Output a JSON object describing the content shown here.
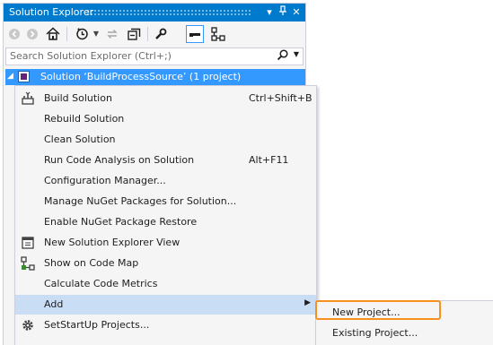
{
  "panel": {
    "title": "Solution Explorer",
    "title_buttons": {
      "dropdown": "▾",
      "pin": "📌",
      "close": "✕"
    }
  },
  "toolbar": {
    "icons": [
      "back-icon",
      "forward-icon",
      "home-icon",
      "history-icon",
      "sync-icon",
      "collapse-all-icon",
      "properties-icon",
      "preview-icon",
      "show-on-code-map-icon"
    ]
  },
  "search": {
    "placeholder": "Search Solution Explorer (Ctrl+;)"
  },
  "solution": {
    "label": "Solution ‘BuildProcessSource’ (1 project)"
  },
  "context_menu": {
    "items": [
      {
        "label": "Build Solution",
        "shortcut": "Ctrl+Shift+B",
        "icon": "build-icon"
      },
      {
        "label": "Rebuild Solution",
        "shortcut": ""
      },
      {
        "label": "Clean Solution",
        "shortcut": ""
      },
      {
        "label": "Run Code Analysis on Solution",
        "shortcut": "Alt+F11"
      },
      {
        "label": "Configuration Manager...",
        "shortcut": ""
      },
      {
        "label": "Manage NuGet Packages for Solution...",
        "shortcut": ""
      },
      {
        "label": "Enable NuGet Package Restore",
        "shortcut": ""
      },
      {
        "label": "New Solution Explorer View",
        "shortcut": "",
        "icon": "new-view-icon"
      },
      {
        "label": "Show on Code Map",
        "shortcut": "",
        "icon": "code-map-icon"
      },
      {
        "label": "Calculate Code Metrics",
        "shortcut": ""
      },
      {
        "label": "Add",
        "shortcut": "",
        "submenu": true
      },
      {
        "label": "SetStartUp Projects...",
        "shortcut": "",
        "icon": "gear-icon"
      }
    ]
  },
  "submenu": {
    "items": [
      {
        "label": "New Project..."
      },
      {
        "label": "Existing Project..."
      }
    ]
  },
  "colors": {
    "accent": "#007acc",
    "selection": "#3399ff",
    "menu_highlight": "#c9def5",
    "focus_ring": "#f7901e"
  }
}
